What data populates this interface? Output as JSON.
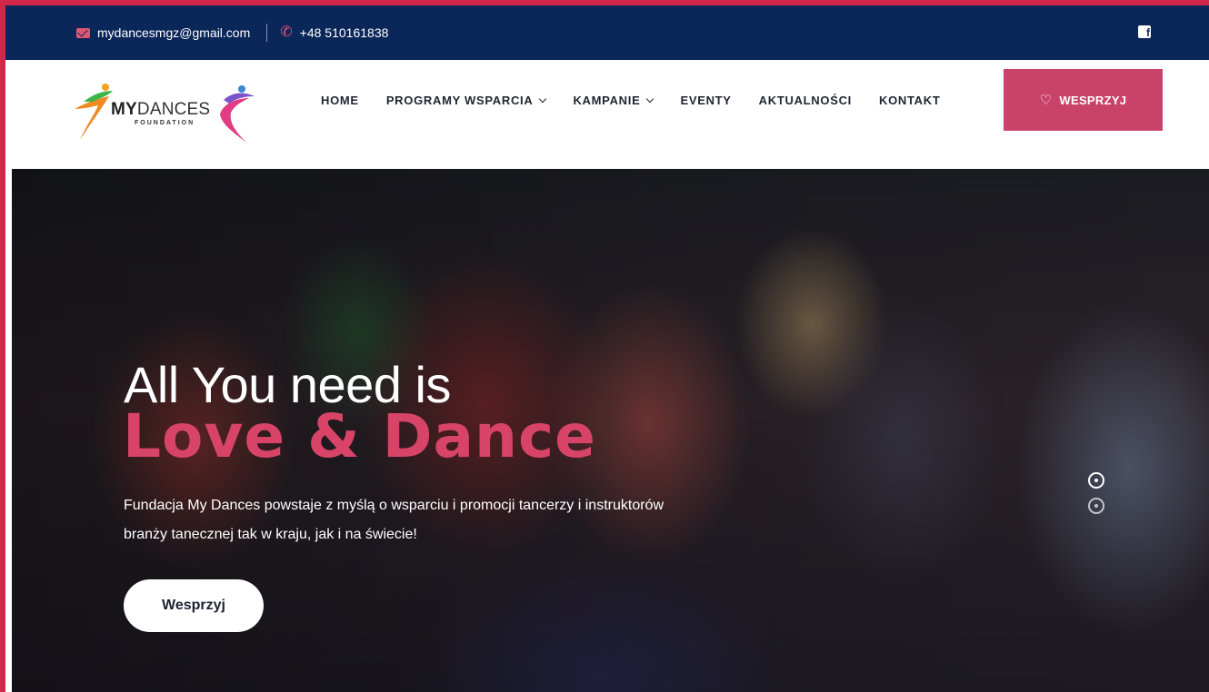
{
  "topbar": {
    "email": "mydancesmgz@gmail.com",
    "phone": "+48 510161838",
    "social_icon": "facebook-icon"
  },
  "logo": {
    "name_bold": "MY",
    "name_thin": "DANCES",
    "subtitle": "FOUNDATION"
  },
  "nav": {
    "items": [
      {
        "label": "HOME",
        "dropdown": false
      },
      {
        "label": "PROGRAMY WSPARCIA",
        "dropdown": true
      },
      {
        "label": "KAMPANIE",
        "dropdown": true
      },
      {
        "label": "EVENTY",
        "dropdown": false
      },
      {
        "label": "AKTUALNOŚCI",
        "dropdown": false
      },
      {
        "label": "KONTAKT",
        "dropdown": false
      }
    ],
    "donate_label": "WESPRZYJ"
  },
  "hero": {
    "title_line1": "All You need is",
    "title_line2": "Love & Dance",
    "text": "Fundacja My Dances powstaje z myślą o wsparciu i promocji tancerzy i instruktorów branży tanecznej tak w kraju, jak i na świecie!",
    "button_label": "Wesprzyj",
    "slides_total": 2,
    "active_slide": 1
  },
  "colors": {
    "brand_pink": "#c9426a",
    "hero_accent": "#d84468",
    "topbar_bg": "#0b2659",
    "frame_border": "#d1284a"
  }
}
